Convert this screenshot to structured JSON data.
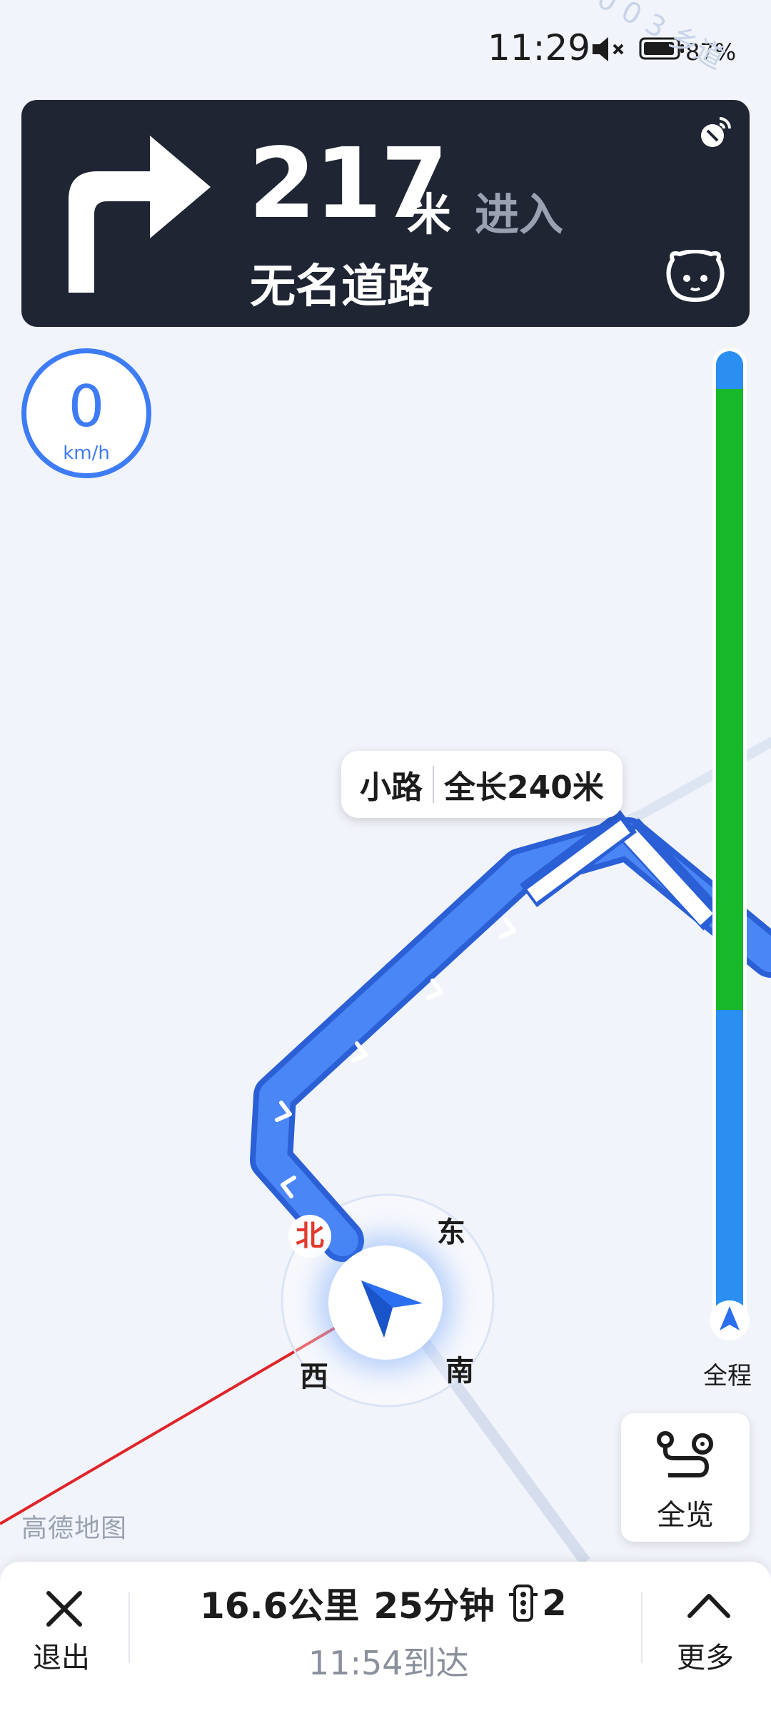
{
  "status_bar": {
    "time": "11:29",
    "battery": "87%",
    "map_label_top": "0 0 3 乡道"
  },
  "nav": {
    "distance": "217",
    "unit": "米",
    "action": "进入",
    "road": "无名道路",
    "turn_icon": "turn-right-icon"
  },
  "speed": {
    "value": "0",
    "unit": "km/h"
  },
  "map": {
    "road_tip_type": "小路",
    "road_tip_length": "全长240米",
    "compass": {
      "north": "北",
      "east": "东",
      "south": "南",
      "west": "西"
    },
    "logo": "高德地图"
  },
  "progress": {
    "label": "全程",
    "completed_fraction": 0.0
  },
  "overview": {
    "label": "全览"
  },
  "bottom": {
    "exit_label": "退出",
    "distance": "16.6公里",
    "duration": "25分钟",
    "traffic_lights": "2",
    "eta": "11:54到达",
    "more_label": "更多"
  },
  "colors": {
    "route_blue": "#3d7cf4",
    "progress_green": "#17b82a",
    "progress_blue": "#2b8ff1",
    "card_dark": "#1f2533",
    "north_red": "#e23a2f"
  }
}
